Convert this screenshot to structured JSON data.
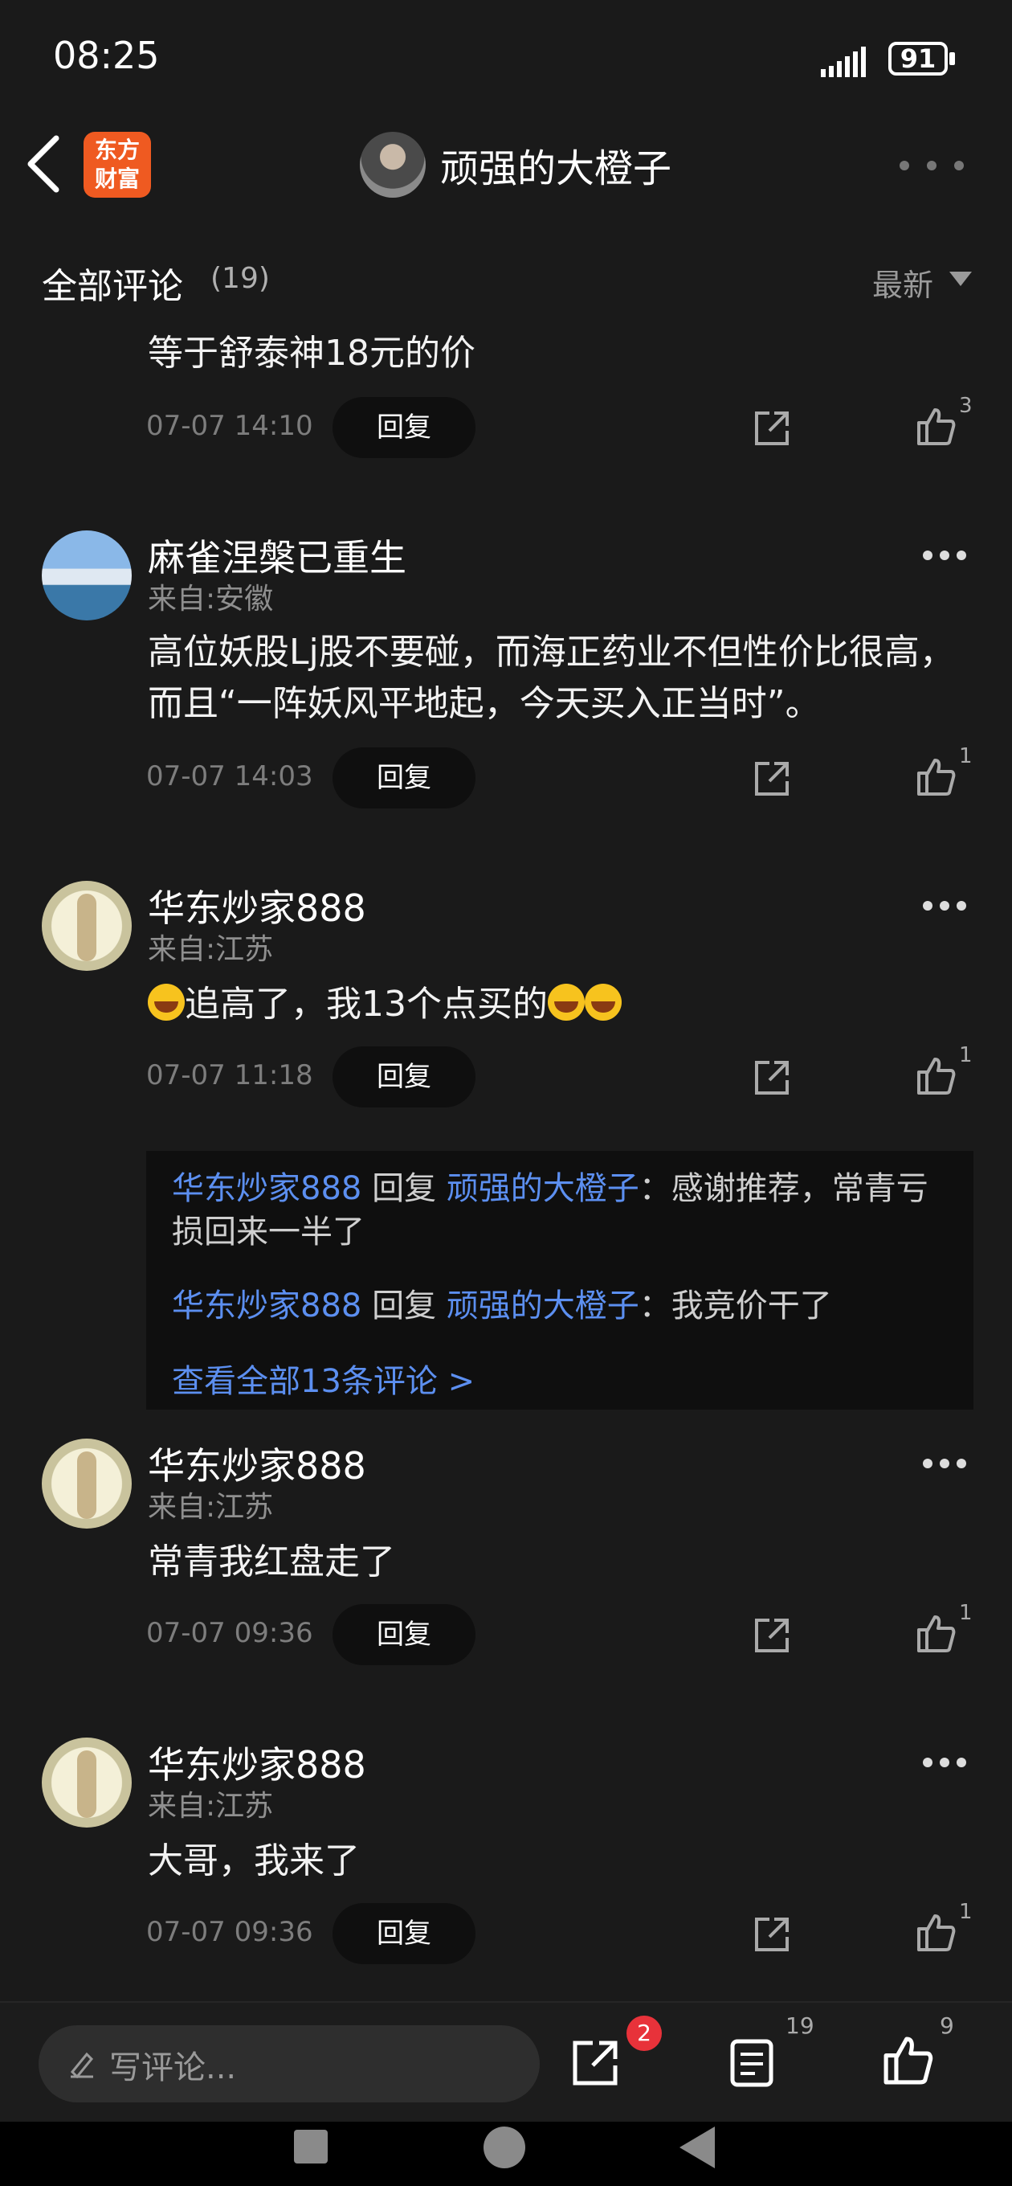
{
  "status_bar": {
    "time": "08:25",
    "battery": "91"
  },
  "header": {
    "logo_line1": "东方",
    "logo_line2": "财富",
    "title": "顽强的大橙子"
  },
  "section": {
    "heading": "全部评论",
    "count": "(19)",
    "sort": "最新"
  },
  "comments": [
    {
      "text": "等于舒泰神18元的价",
      "time": "07-07 14:10",
      "reply": "回复",
      "likes": "3"
    },
    {
      "user": "麻雀涅槃已重生",
      "from": "来自:安徽",
      "text": "高位妖股Lj股不要碰，而海正药业不但性价比很高，而且“一阵妖风平地起，今天买入正当时”。",
      "time": "07-07 14:03",
      "reply": "回复",
      "likes": "1"
    },
    {
      "user": "华东炒家888",
      "from": "来自:江苏",
      "text_a": "追高了，我13个点买的",
      "time": "07-07 11:18",
      "reply": "回复",
      "likes": "1"
    },
    {
      "user": "华东炒家888",
      "from": "来自:江苏",
      "text": "常青我红盘走了",
      "time": "07-07 09:36",
      "reply": "回复",
      "likes": "1"
    },
    {
      "user": "华东炒家888",
      "from": "来自:江苏",
      "text": "大哥，我来了",
      "time": "07-07 09:36",
      "reply": "回复",
      "likes": "1"
    }
  ],
  "replies": {
    "items": [
      {
        "user": "华东炒家888",
        "verb": " 回复 ",
        "target": "顽强的大橙子",
        "text": "：感谢推荐，常青亏损回来一半了"
      },
      {
        "user": "华东炒家888",
        "verb": " 回复 ",
        "target": "顽强的大橙子",
        "text": "：我竞价干了"
      }
    ],
    "view_all": "查看全部13条评论 >"
  },
  "bottom_bar": {
    "placeholder": "写评论...",
    "share_badge": "2",
    "comment_count": "19",
    "like_count": "9"
  }
}
